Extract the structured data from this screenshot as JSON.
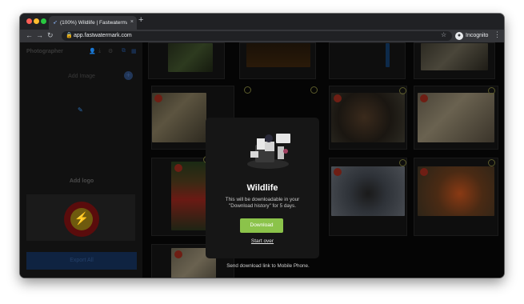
{
  "browser": {
    "tab_title": "(100%) Wildlife | Fastwatermar...",
    "tab_close": "×",
    "new_tab": "+",
    "url": "app.fastwatermark.com",
    "nav": {
      "back": "←",
      "forward": "→",
      "reload": "↻"
    },
    "lock": "🔒",
    "star": "☆",
    "menu": "⋮",
    "incognito_label": "Incognito",
    "incognito_glyph": "●"
  },
  "sidebar": {
    "title": "Photographer",
    "icons": [
      "user-icon",
      "download-icon",
      "gear-icon",
      "layers-icon",
      "grid-icon"
    ],
    "add_image_label": "Add Image",
    "add_plus": "+",
    "brush_glyph": "✎",
    "add_logo_label": "Add logo",
    "logo_glyph": "⚡",
    "export_label": "Export All"
  },
  "modal": {
    "title": "Wildlife",
    "description": "This will be downloadable in your \"Download history\" for 5 days.",
    "download_label": "Download",
    "start_over_label": "Start over"
  },
  "send_link": "Send download link to Mobile Phone.",
  "colors": {
    "download_button": "#8bc34a",
    "background": "#050505",
    "modal_background": "#161616"
  }
}
